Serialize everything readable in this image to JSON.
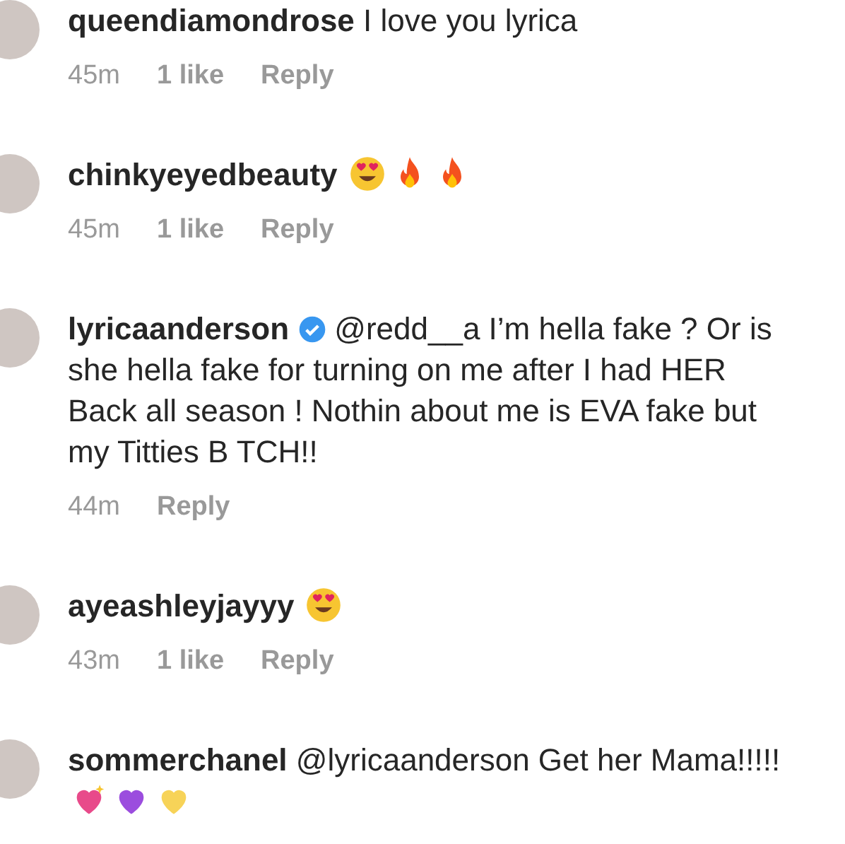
{
  "comments": [
    {
      "username": "queendiamondrose",
      "verified": false,
      "text": "I love you lyrica",
      "time": "45m",
      "likes": "1 like",
      "reply": "Reply"
    },
    {
      "username": "chinkyeyedbeauty",
      "verified": false,
      "emojis": [
        {
          "kind": "heart_eyes"
        },
        {
          "kind": "fire"
        },
        {
          "kind": "fire"
        }
      ],
      "time": "45m",
      "likes": "1 like",
      "reply": "Reply"
    },
    {
      "username": "lyricaanderson",
      "verified": true,
      "text": "@redd__a I’m hella fake ? Or is she hella fake for turning on me after I had HER Back all season ! Nothin about me is EVA fake but my Titties B TCH!!",
      "time": "44m",
      "reply": "Reply"
    },
    {
      "username": "ayeashleyjayyy",
      "verified": false,
      "emojis": [
        {
          "kind": "heart_eyes"
        }
      ],
      "time": "43m",
      "likes": "1 like",
      "reply": "Reply"
    },
    {
      "username": "sommerchanel",
      "verified": false,
      "text": "@lyricaanderson Get her Mama!!!!!",
      "emojis": [
        {
          "kind": "sparkling_heart"
        },
        {
          "kind": "purple_heart"
        },
        {
          "kind": "yellow_heart"
        }
      ]
    }
  ]
}
